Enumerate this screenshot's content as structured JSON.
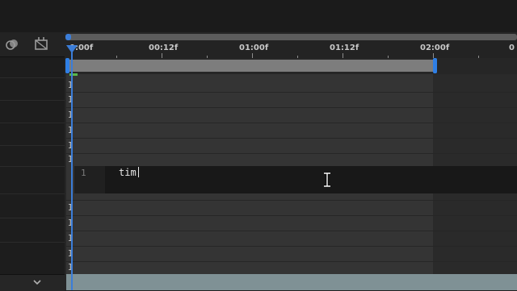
{
  "toolbar": {
    "icons": [
      "motion-blur-icon",
      "draft-3d-icon"
    ]
  },
  "ruler": {
    "labels": [
      "0:00f",
      "00:12f",
      "01:00f",
      "01:12f",
      "02:00f"
    ]
  },
  "expression_editor": {
    "line_number": "1",
    "text": "tim"
  },
  "colors": {
    "playhead": "#3b7dd8",
    "range_handle": "#2f7fe5",
    "bottom_bar": "#7f9195"
  }
}
